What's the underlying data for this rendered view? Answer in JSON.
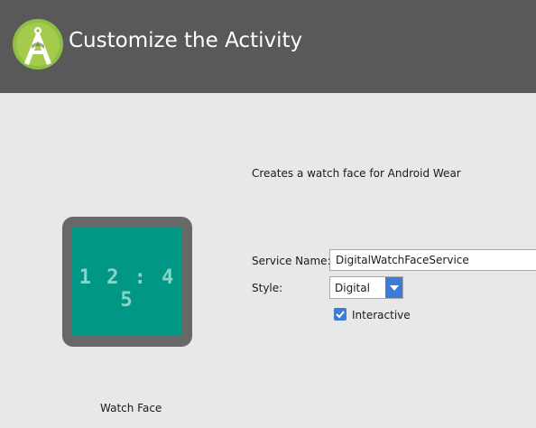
{
  "header": {
    "title": "Customize the Activity",
    "logo_icon": "android-studio-logo-icon",
    "background": "#595959"
  },
  "main": {
    "description": "Creates a watch face for Android Wear",
    "preview": {
      "time": "12:45",
      "caption": "Watch Face",
      "screen_color": "#009784",
      "bezel_color": "#686868"
    },
    "form": {
      "service_name_label": "Service Name:",
      "service_name_value": "DigitalWatchFaceService",
      "style_label": "Style:",
      "style_value": "Digital",
      "interactive_label": "Interactive",
      "interactive_checked": true,
      "accent_color": "#3c7bd6"
    }
  }
}
